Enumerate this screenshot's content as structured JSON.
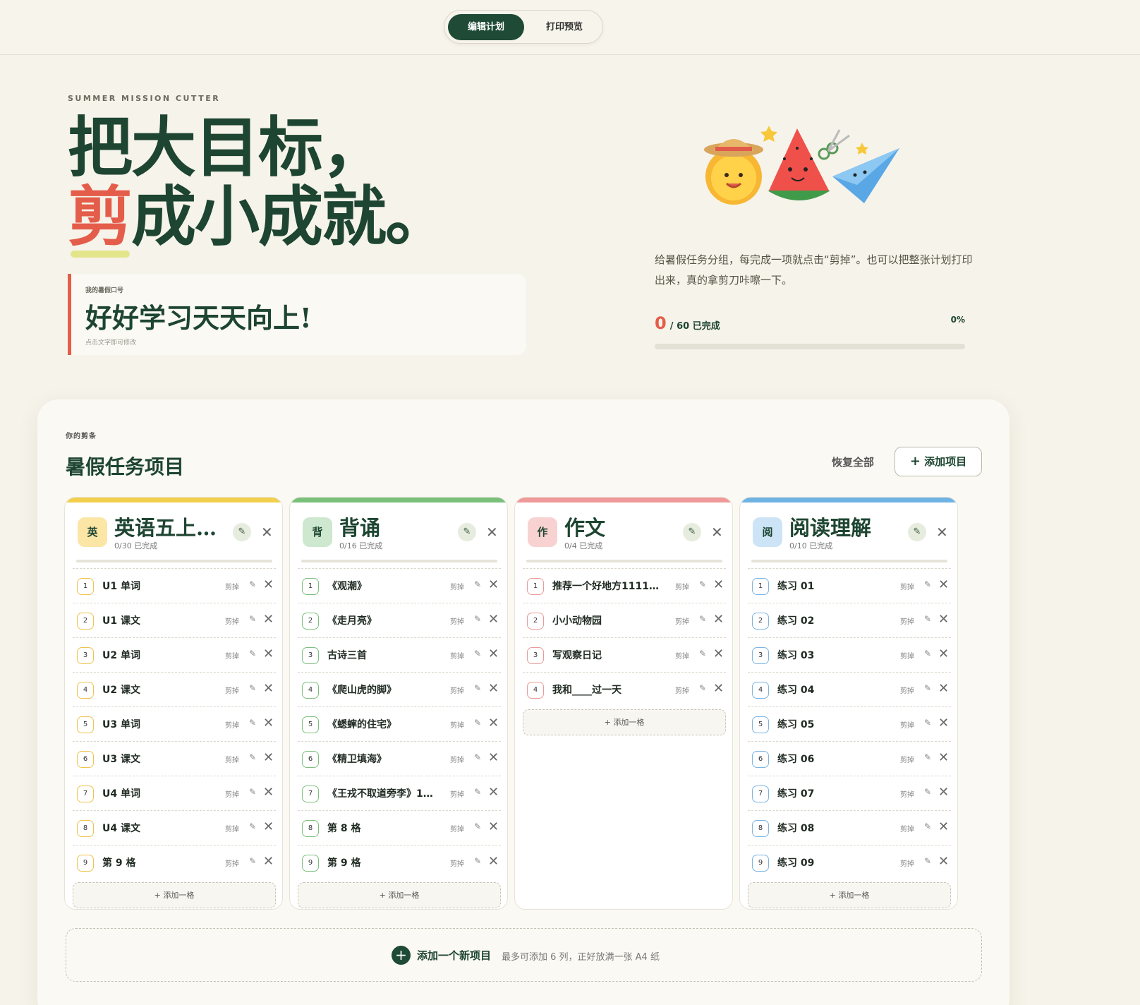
{
  "tabs": {
    "edit": "编辑计划",
    "print": "打印预览"
  },
  "hero": {
    "eyebrow": "SUMMER MISSION CUTTER",
    "line1": "把大目标，",
    "line2_red": "剪",
    "line2_rest": "成小成就。",
    "slogan_label": "我的暑假口号",
    "slogan": "好好学习天天向上!",
    "slogan_hint": "点击文字即可修改",
    "description": "给暑假任务分组，每完成一项就点击“剪掉”。也可以把整张计划打印出来，真的拿剪刀咔嚓一下。",
    "done_count": "0",
    "done_total": "/ 60 已完成",
    "percent": "0%",
    "progress": 0
  },
  "board": {
    "label": "你的剪条",
    "title": "暑假任务项目",
    "restore": "恢复全部",
    "add_project": "添加项目",
    "add_cell": "+ 添加一格",
    "cut": "剪掉",
    "add_new": "添加一个新项目",
    "add_new_hint": "最多可添加 6 列，正好放满一张 A4 纸"
  },
  "columns": [
    {
      "badge": "英",
      "name": "英语五上…",
      "count": "0/30 已完成",
      "color": "#f2cf4c",
      "badge_bg": "#fbe6a6",
      "num_border": "#f0c34e",
      "items": [
        "U1 单词",
        "U1 课文",
        "U2 单词",
        "U2 课文",
        "U3 单词",
        "U3 课文",
        "U4 单词",
        "U4 课文",
        "第 9 格"
      ]
    },
    {
      "badge": "背",
      "name": "背诵",
      "count": "0/16 已完成",
      "color": "#79c17a",
      "badge_bg": "#cde8cf",
      "num_border": "#7dc07e",
      "items": [
        "《观潮》",
        "《走月亮》",
        "古诗三首",
        "《爬山虎的脚》",
        "《蟋蟀的住宅》",
        "《精卫填海》",
        "《王戎不取道旁李》11…",
        "第 8 格",
        "第 9 格"
      ]
    },
    {
      "badge": "作",
      "name": "作文",
      "count": "0/4 已完成",
      "color": "#ef9a98",
      "badge_bg": "#f8d2d1",
      "num_border": "#e89a98",
      "items": [
        "推荐一个好地方111111…",
        "小小动物园",
        "写观察日记",
        "我和____过一天"
      ]
    },
    {
      "badge": "阅",
      "name": "阅读理解",
      "count": "0/10 已完成",
      "color": "#6fb3e4",
      "badge_bg": "#cde4f6",
      "num_border": "#7cb4e2",
      "items": [
        "练习 01",
        "练习 02",
        "练习 03",
        "练习 04",
        "练习 05",
        "练习 06",
        "练习 07",
        "练习 08",
        "练习 09"
      ]
    }
  ]
}
